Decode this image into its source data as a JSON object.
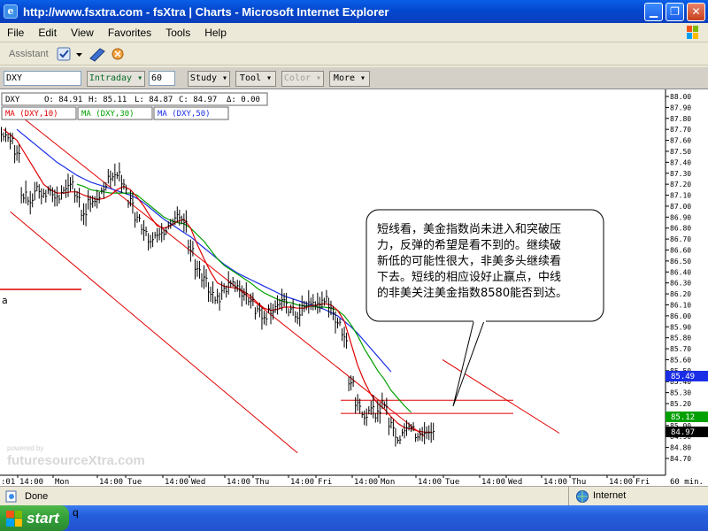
{
  "window": {
    "title": "http://www.fsxtra.com - fsXtra | Charts - Microsoft Internet Explorer"
  },
  "menu": {
    "items": [
      "File",
      "Edit",
      "View",
      "Favorites",
      "Tools",
      "Help"
    ]
  },
  "assistant": {
    "label": "Assistant"
  },
  "chart_toolbar": {
    "symbol": "DXY",
    "interval_mode": "Intraday",
    "interval_value": "60",
    "study": "Study",
    "tool": "Tool",
    "color": "Color",
    "more": "More"
  },
  "quote_box": {
    "symbol": "DXY",
    "open": "O: 84.91",
    "high": "H: 85.11",
    "low": "L: 84.87",
    "close": "C: 84.97",
    "change": "Δ: 0.00"
  },
  "ma_legend": [
    "MA (DXY,10)",
    "MA (DXY,30)",
    "MA (DXY,50)"
  ],
  "left_marker": "a",
  "annotation": {
    "lines": [
      "短线看，美金指数尚未进入和突破压",
      "力，反弹的希望是看不到的。继续破",
      "新低的可能性很大，非美多头继续看",
      "下去。短线的相应设好止赢点，中线",
      "的非美关注美金指数8580能否到达。"
    ]
  },
  "watermark": {
    "top": "powered by",
    "bottom": "futuresourceXtra.com"
  },
  "price_labels": {
    "ma50": "85.49",
    "ma30": "85.12",
    "last": "84.97"
  },
  "x_axis_corner": ":01",
  "x_axis_unit": "60 min.",
  "status": {
    "left": "Done",
    "zone": "Internet"
  },
  "taskbar": {
    "start": "start",
    "task": "q"
  },
  "colors": {
    "ma10": "#e00000",
    "ma30": "#00a000",
    "ma50": "#1a2ee6",
    "channel": "#e00000",
    "price": "#000000"
  },
  "chart_data": {
    "type": "line",
    "series_type": "hlc-bars",
    "y_axis": {
      "min": 84.7,
      "max": 88.0,
      "ticks": [
        "88.00",
        "87.90",
        "87.80",
        "87.70",
        "87.60",
        "87.50",
        "87.40",
        "87.30",
        "87.20",
        "87.10",
        "87.00",
        "86.90",
        "86.80",
        "86.70",
        "86.60",
        "86.50",
        "86.40",
        "86.30",
        "86.20",
        "86.10",
        "86.00",
        "85.90",
        "85.80",
        "85.70",
        "85.60",
        "85.50",
        "85.40",
        "85.30",
        "85.20",
        "85.10",
        "85.00",
        "84.90",
        "84.80",
        "84.70"
      ]
    },
    "x_axis": {
      "labels": [
        "14:00",
        "Mon",
        "14:00",
        "Tue",
        "14:00",
        "Wed",
        "14:00",
        "Thu",
        "14:00",
        "Fri",
        "14:00",
        "Mon",
        "14:00",
        "Tue",
        "14:00",
        "Wed",
        "14:00",
        "Thu",
        "14:00",
        "Fri"
      ]
    },
    "price": [
      87.65,
      87.6,
      87.5,
      87.1,
      87.05,
      87.15,
      87.1,
      87.12,
      87.08,
      87.15,
      87.2,
      87.1,
      86.9,
      87.05,
      87.05,
      87.15,
      87.25,
      87.3,
      87.18,
      87.05,
      86.9,
      86.8,
      86.7,
      86.72,
      86.75,
      86.85,
      86.9,
      86.85,
      86.6,
      86.4,
      86.35,
      86.2,
      86.15,
      86.25,
      86.3,
      86.25,
      86.2,
      86.15,
      86.05,
      86.0,
      86.05,
      86.1,
      86.12,
      86.05,
      86.0,
      86.08,
      86.12,
      86.1,
      86.15,
      86.05,
      85.95,
      85.8,
      85.4,
      85.2,
      85.1,
      85.15,
      85.1,
      85.2,
      85.0,
      84.88,
      84.95,
      85.0,
      84.9,
      84.92,
      84.95
    ],
    "ma10": [
      87.7,
      87.65,
      87.6,
      87.5,
      87.4,
      87.3,
      87.2,
      87.15,
      87.12,
      87.12,
      87.13,
      87.13,
      87.1,
      87.08,
      87.06,
      87.07,
      87.1,
      87.15,
      87.18,
      87.15,
      87.08,
      87.0,
      86.9,
      86.82,
      86.8,
      86.82,
      86.86,
      86.88,
      86.8,
      86.65,
      86.52,
      86.4,
      86.3,
      86.27,
      86.26,
      86.25,
      86.22,
      86.18,
      86.12,
      86.07,
      86.05,
      86.06,
      86.08,
      86.08,
      86.07,
      86.07,
      86.09,
      86.1,
      86.11,
      86.1,
      86.05,
      85.95,
      85.75,
      85.55,
      85.4,
      85.28,
      85.2,
      85.15,
      85.08,
      85.02,
      84.98,
      84.97,
      84.95,
      84.94,
      84.94
    ],
    "ma30": [
      null,
      null,
      null,
      null,
      null,
      null,
      null,
      null,
      null,
      null,
      null,
      87.2,
      87.18,
      87.15,
      87.14,
      87.13,
      87.12,
      87.12,
      87.12,
      87.12,
      87.1,
      87.05,
      87.0,
      86.95,
      86.9,
      86.87,
      86.85,
      86.84,
      86.8,
      86.74,
      86.68,
      86.6,
      86.52,
      86.46,
      86.42,
      86.38,
      86.34,
      86.3,
      86.25,
      86.21,
      86.18,
      86.15,
      86.13,
      86.12,
      86.1,
      86.09,
      86.09,
      86.08,
      86.08,
      86.07,
      86.05,
      86.0,
      85.92,
      85.82,
      85.7,
      85.6,
      85.5,
      85.42,
      85.32,
      85.25,
      85.18,
      85.12,
      null,
      null,
      null
    ],
    "ma50": [
      null,
      null,
      87.7,
      87.65,
      87.6,
      87.55,
      87.5,
      87.45,
      87.4,
      87.36,
      87.32,
      87.28,
      87.25,
      87.22,
      87.2,
      87.18,
      87.16,
      87.14,
      87.12,
      87.1,
      87.07,
      87.03,
      86.98,
      86.93,
      86.88,
      86.84,
      86.8,
      86.76,
      86.72,
      86.67,
      86.62,
      86.57,
      86.52,
      86.47,
      86.43,
      86.39,
      86.36,
      86.33,
      86.3,
      86.27,
      86.24,
      86.21,
      86.18,
      86.16,
      86.14,
      86.12,
      86.1,
      86.08,
      86.06,
      86.03,
      86.0,
      85.95,
      85.9,
      85.84,
      85.77,
      85.7,
      85.63,
      85.56,
      85.49,
      null,
      null,
      null,
      null,
      null,
      null
    ],
    "channel_upper": [
      [
        3,
        87.8
      ],
      [
        63,
        84.9
      ]
    ],
    "channel_lower": [
      [
        1,
        86.95
      ],
      [
        44,
        84.75
      ]
    ],
    "support_lines": [
      85.23,
      85.11
    ],
    "ylim": [
      84.7,
      88.0
    ],
    "grid": false
  }
}
